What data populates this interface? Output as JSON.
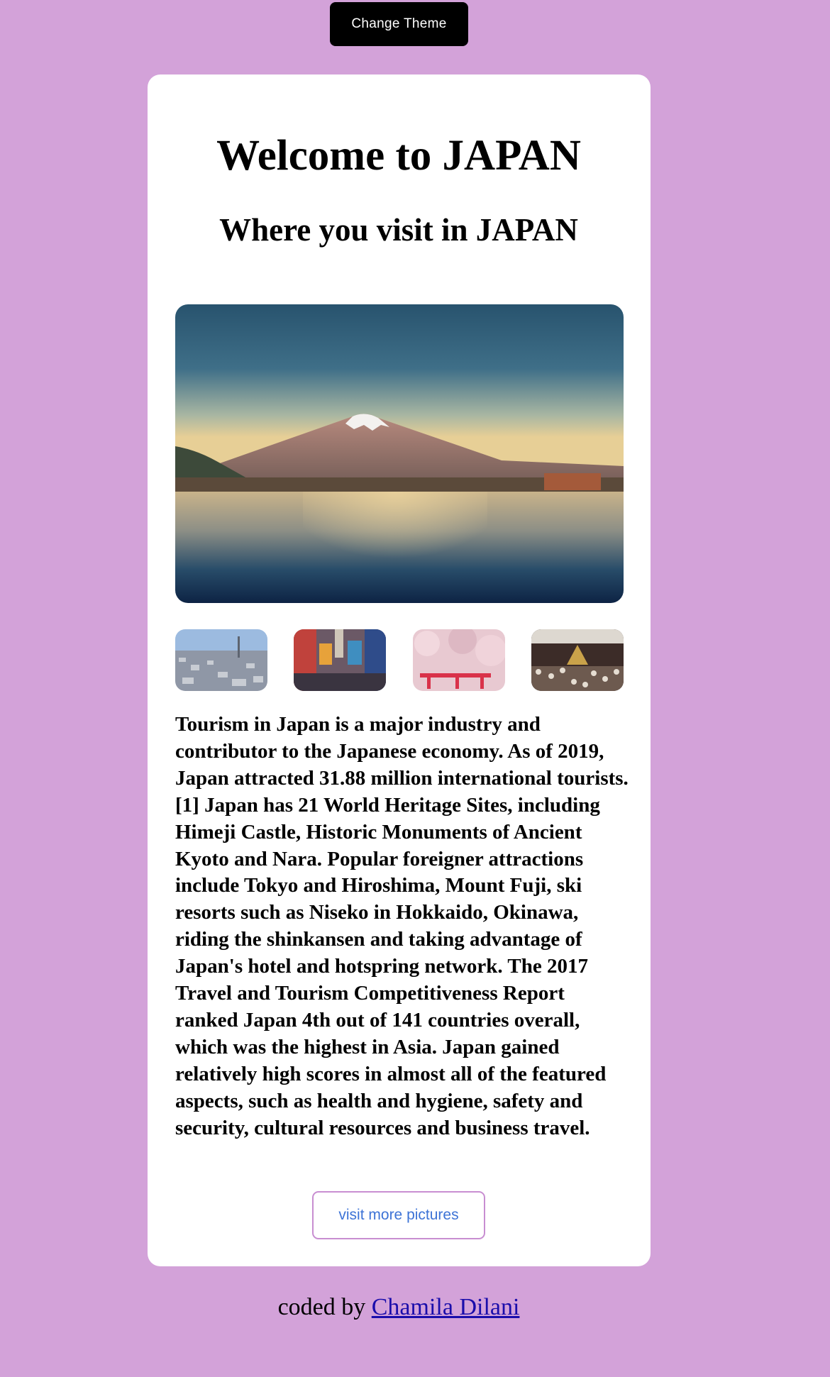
{
  "header": {
    "theme_button_label": "Change Theme"
  },
  "card": {
    "title": "Welcome to JAPAN",
    "subtitle": "Where you visit in JAPAN",
    "hero_image": "mount-fuji-lake-photo",
    "thumbnails": [
      {
        "image": "tokyo-skyline-photo"
      },
      {
        "image": "osaka-street-photo"
      },
      {
        "image": "cherry-blossom-shrine-photo"
      },
      {
        "image": "festival-crowd-photo"
      }
    ],
    "description": "Tourism in Japan is a major industry and contributor to the Japanese economy. As of 2019, Japan attracted 31.88 million international tourists.[1] Japan has 21 World Heritage Sites, including Himeji Castle, Historic Monuments of Ancient Kyoto and Nara. Popular foreigner attractions include Tokyo and Hiroshima, Mount Fuji, ski resorts such as Niseko in Hokkaido, Okinawa, riding the shinkansen and taking advantage of Japan's hotel and hotspring network. The 2017 Travel and Tourism Competitiveness Report ranked Japan 4th out of 141 countries overall, which was the highest in Asia. Japan gained relatively high scores in almost all of the featured aspects, such as health and hygiene, safety and security, cultural resources and business travel.",
    "more_button_label": "visit more pictures"
  },
  "footer": {
    "prefix": "coded by",
    "author_link": "Chamila Dilani"
  },
  "colors": {
    "page_background": "#d3a2d9",
    "card_background": "#ffffff",
    "theme_button_background": "#000000",
    "more_button_border": "#c88ed1",
    "more_button_text": "#3d73d6",
    "link": "#1a0dab"
  }
}
